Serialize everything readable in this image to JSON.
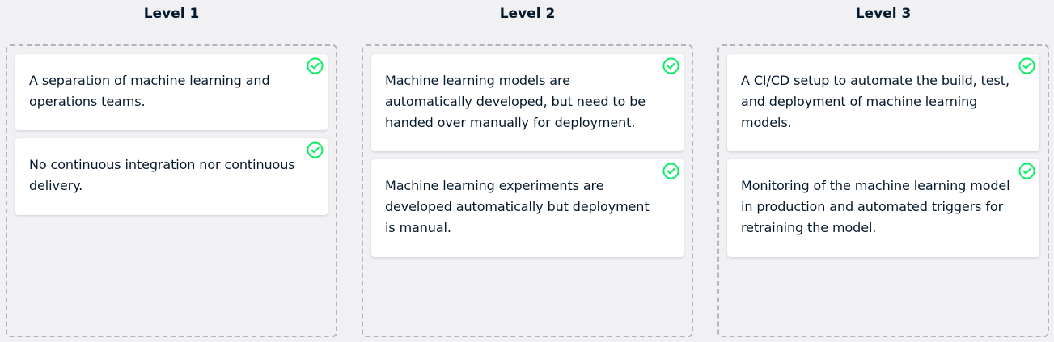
{
  "columns": [
    {
      "title": "Level 1",
      "cards": [
        {
          "text": "A separation of machine learning and operations teams.",
          "status": "correct"
        },
        {
          "text": "No continuous integration nor continuous delivery.",
          "status": "correct"
        }
      ]
    },
    {
      "title": "Level 2",
      "cards": [
        {
          "text": "Machine learning models are automatically developed, but need to be handed over manually for deployment.",
          "status": "correct"
        },
        {
          "text": "Machine learning experiments are developed automatically but deployment is manual.",
          "status": "correct"
        }
      ]
    },
    {
      "title": "Level 3",
      "cards": [
        {
          "text": "A CI/CD setup to automate the build, test, and deployment of machine learning models.",
          "status": "correct"
        },
        {
          "text": "Monitoring of the machine learning model in production and automated triggers for retraining the model.",
          "status": "correct"
        }
      ]
    }
  ],
  "colors": {
    "background": "#f1f1f4",
    "card": "#ffffff",
    "text": "#05192d",
    "dashed_border": "#b5b3c2",
    "check": "#03ef62"
  },
  "icons": {
    "correct": "check-circle-icon"
  }
}
